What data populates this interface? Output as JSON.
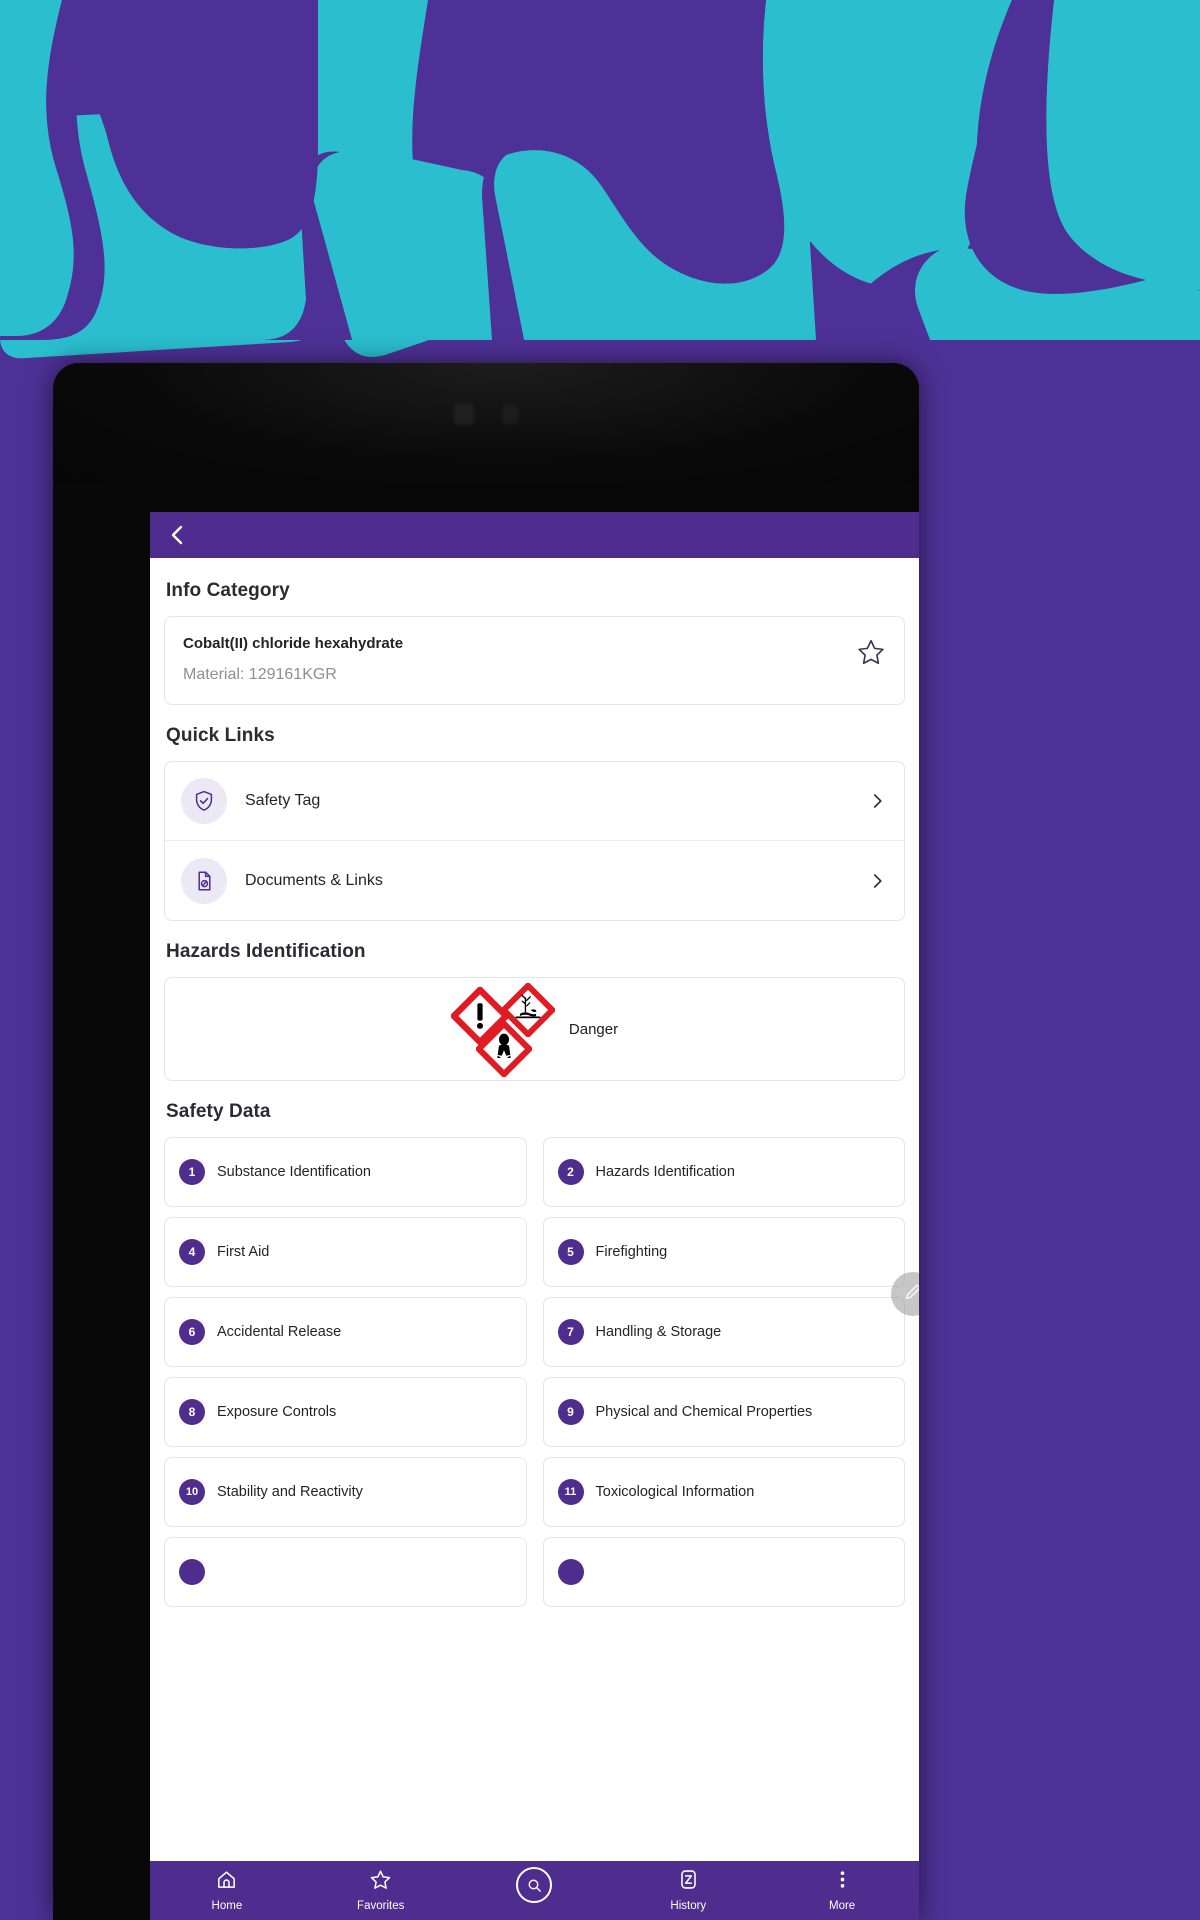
{
  "background": {
    "purple": "#4E3196",
    "teal": "#2BBECE"
  },
  "device": {
    "frame_color": "#080808"
  },
  "app": {
    "accent": "#4F2D8F",
    "appbar": {
      "back_icon": "chevron-left-icon"
    },
    "page_title": "Info Category",
    "material": {
      "name": "Cobalt(II) chloride hexahydrate",
      "code": "Material: 129161KGR",
      "favorite_icon": "star-outline-icon"
    },
    "quick_links": {
      "title": "Quick Links",
      "items": [
        {
          "label": "Safety Tag",
          "icon": "shield-check-icon",
          "chevron": "chevron-right-icon"
        },
        {
          "label": "Documents & Links",
          "icon": "document-link-icon",
          "chevron": "chevron-right-icon"
        }
      ]
    },
    "hazards": {
      "title": "Hazards Identification",
      "signal_word": "Danger",
      "pictograms": [
        {
          "name": "ghs07-exclamation-mark-pictogram"
        },
        {
          "name": "ghs09-environment-pictogram"
        },
        {
          "name": "ghs08-health-hazard-pictogram"
        }
      ]
    },
    "safety_data": {
      "title": "Safety Data",
      "items": [
        {
          "num": "1",
          "label": "Substance Identification"
        },
        {
          "num": "2",
          "label": "Hazards Identification"
        },
        {
          "num": "4",
          "label": "First Aid"
        },
        {
          "num": "5",
          "label": "Firefighting"
        },
        {
          "num": "6",
          "label": "Accidental Release"
        },
        {
          "num": "7",
          "label": "Handling & Storage"
        },
        {
          "num": "8",
          "label": "Exposure Controls"
        },
        {
          "num": "9",
          "label": "Physical and Chemical Properties"
        },
        {
          "num": "10",
          "label": "Stability and Reactivity"
        },
        {
          "num": "11",
          "label": "Toxicological Information"
        },
        {
          "num": "",
          "label": ""
        },
        {
          "num": "",
          "label": ""
        }
      ]
    },
    "edit_fab": {
      "icon": "pencil-edit-icon"
    },
    "bottom_nav": [
      {
        "label": "Home",
        "icon": "home-icon"
      },
      {
        "label": "Favorites",
        "icon": "star-outline-icon"
      },
      {
        "label": "",
        "icon": "search-icon"
      },
      {
        "label": "History",
        "icon": "history-icon"
      },
      {
        "label": "More",
        "icon": "more-vertical-icon"
      }
    ]
  }
}
